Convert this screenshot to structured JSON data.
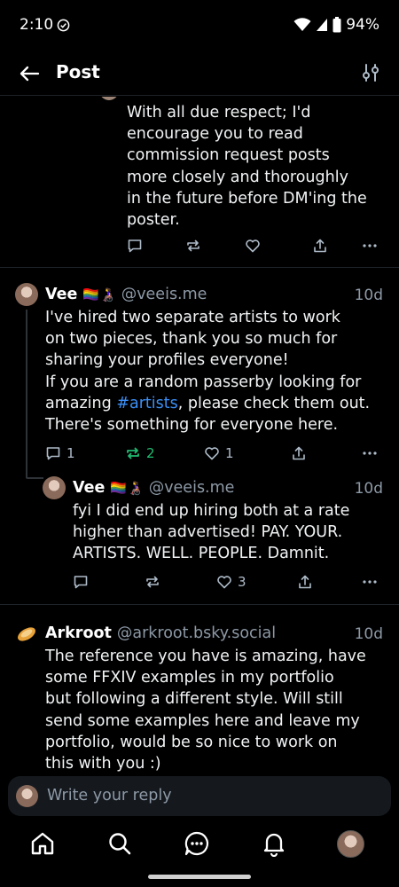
{
  "status_bar": {
    "time": "2:10",
    "battery": "94%"
  },
  "header": {
    "title": "Post"
  },
  "post_top": {
    "text_lines": [
      "With all due respect; I'd",
      "encourage you to read",
      "commission request posts",
      "more closely and thoroughly",
      "in the future before DM'ing the",
      "poster."
    ]
  },
  "post_vee": {
    "name": "Vee",
    "flags": "🏳️‍🌈👩‍🦽",
    "handle": "@veeis.me",
    "time": "10d",
    "text_lines": [
      "I've hired two separate artists to work",
      "on two pieces, thank you so much for",
      "sharing your profiles everyone!",
      "If you are a random passerby looking for"
    ],
    "line5_before": "amazing ",
    "hashtag": "#artists",
    "line5_after": ", please check them out.",
    "line6": "There's something for everyone here.",
    "replies": "1",
    "reposts": "2",
    "likes": "1"
  },
  "post_vee_reply": {
    "name": "Vee",
    "flags": "🏳️‍🌈👩‍🦽",
    "handle": "@veeis.me",
    "time": "10d",
    "text_lines": [
      "fyi I did end up hiring both at a rate",
      "higher than advertised! PAY. YOUR.",
      "ARTISTS. WELL. PEOPLE. Damnit."
    ],
    "likes": "3"
  },
  "post_arkroot": {
    "name": "Arkroot",
    "handle": "@arkroot.bsky.social",
    "time": "10d",
    "text_lines": [
      "The reference you have is amazing, have",
      "some FFXIV examples in my portfolio",
      "but following a different style. Will still",
      "send some examples here and leave my",
      "portfolio, would be so nice to work on",
      "this with you :)"
    ]
  },
  "reply_bar": {
    "placeholder": "Write your reply"
  },
  "colors": {
    "accent": "#3b8ff6",
    "repost_active": "#20bc73",
    "muted": "#8d99a6"
  }
}
